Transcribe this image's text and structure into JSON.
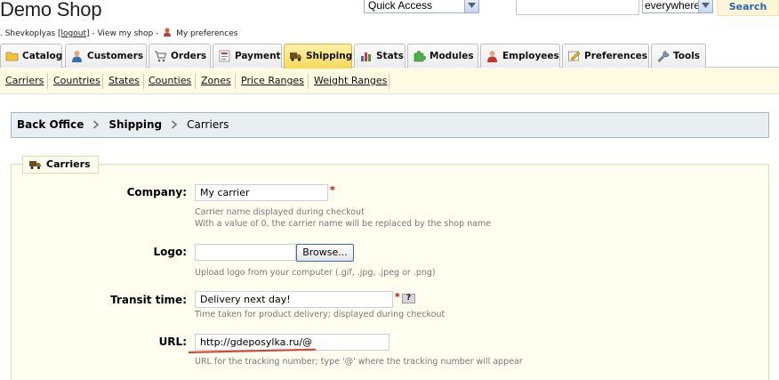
{
  "header": {
    "shop_title": "Demo Shop",
    "user_prefix": ". Shevkoplyas [",
    "logout_label": "logout",
    "user_mid": "] - View my shop -",
    "preferences_label": "My preferences"
  },
  "quick_access": {
    "selected": "Quick Access"
  },
  "search": {
    "value": "",
    "scope": "everywhere",
    "button_label": "Search"
  },
  "tabs": [
    {
      "label": "Catalog",
      "icon": "folder-icon"
    },
    {
      "label": "Customers",
      "icon": "user-icon"
    },
    {
      "label": "Orders",
      "icon": "cart-icon"
    },
    {
      "label": "Payment",
      "icon": "payment-icon"
    },
    {
      "label": "Shipping",
      "icon": "truck-icon",
      "active": true
    },
    {
      "label": "Stats",
      "icon": "chart-icon"
    },
    {
      "label": "Modules",
      "icon": "puzzle-icon"
    },
    {
      "label": "Employees",
      "icon": "employee-icon"
    },
    {
      "label": "Preferences",
      "icon": "preferences-icon"
    },
    {
      "label": "Tools",
      "icon": "wrench-icon"
    }
  ],
  "subtabs": [
    "Carriers",
    "Countries",
    "States",
    "Counties",
    "Zones",
    "Price Ranges",
    "Weight Ranges"
  ],
  "breadcrumb": {
    "level1": "Back Office",
    "level2": "Shipping",
    "current": "Carriers"
  },
  "section": {
    "legend": "Carriers"
  },
  "form": {
    "company": {
      "label": "Company:",
      "value": "My carrier",
      "required_mark": "*",
      "hint_line1": "Carrier name displayed during checkout",
      "hint_line2": "With a value of 0, the carrier name will be replaced by the shop name"
    },
    "logo": {
      "label": "Logo:",
      "value": "",
      "browse_label": "Browse...",
      "hint": "Upload logo from your computer (.gif, .jpg, .jpeg or .png)"
    },
    "transit": {
      "label": "Transit time:",
      "value": "Delivery next day!",
      "required_mark": "*",
      "help_label": "?",
      "hint": "Time taken for product delivery; displayed during checkout"
    },
    "url": {
      "label": "URL:",
      "value": "http://gdeposylka.ru/@",
      "hint": "URL for the tracking number; type '@' where the tracking number will appear"
    }
  },
  "colors": {
    "active_tab": "#f7d85a",
    "subtab_bar": "#fffbe3",
    "search_text": "#2a64b6",
    "required": "#cc0000",
    "annotation": "#e03a2e"
  }
}
